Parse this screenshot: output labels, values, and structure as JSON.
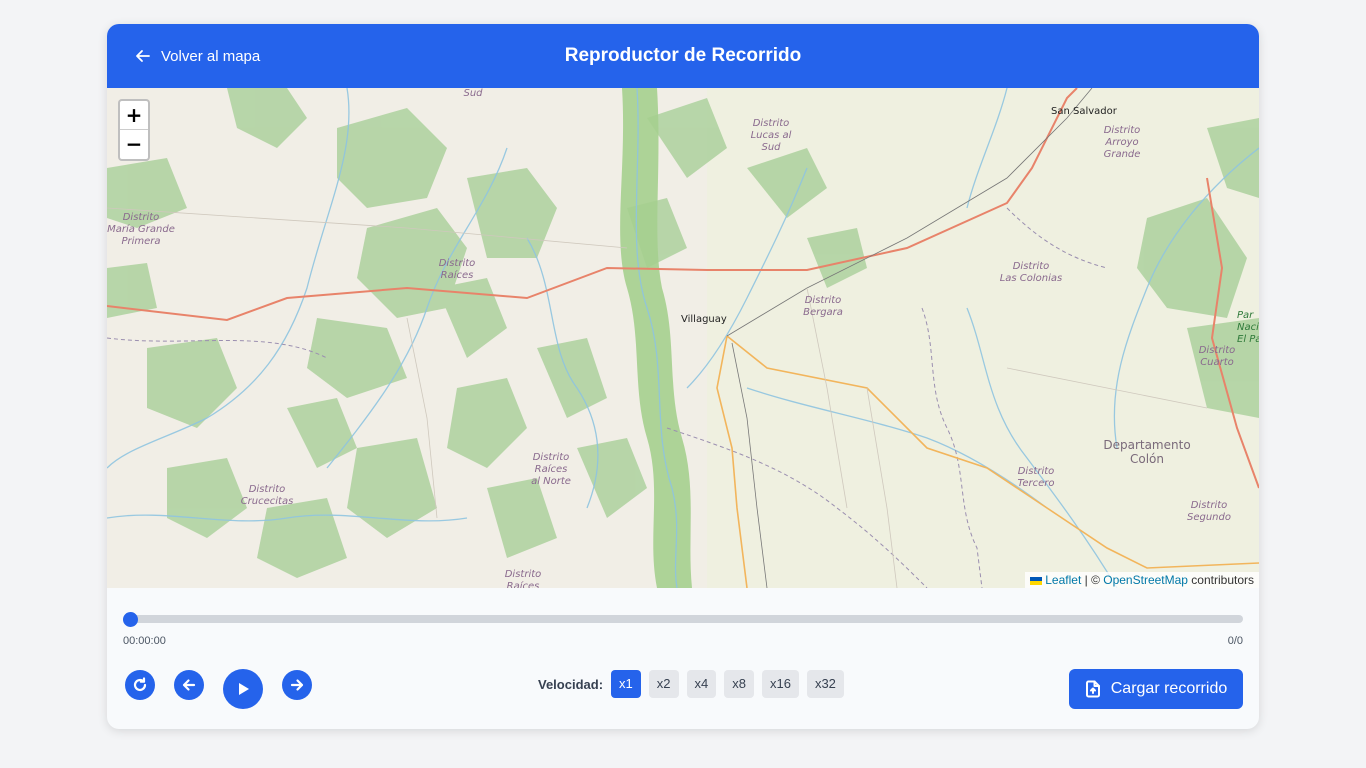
{
  "header": {
    "back_label": "Volver al mapa",
    "title": "Reproductor de Recorrido"
  },
  "map": {
    "zoom_in": "+",
    "zoom_out": "−",
    "attribution": {
      "leaflet": "Leaflet",
      "separator": " | © ",
      "osm": "OpenStreetMap",
      "suffix": " contributors"
    },
    "labels": {
      "sud_top": "Sud",
      "san_salvador": "San Salvador",
      "lucas_al_sud": "Distrito\nLucas al\nSud",
      "arroyo_grande": "Distrito\nArroyo\nGrande",
      "maria_grande": "Distrito\nMaría Grande\nPrimera",
      "raices": "Distrito\nRaíces",
      "las_colonias": "Distrito\nLas Colonias",
      "bergara": "Distrito\nBergara",
      "villaguay": "Villaguay",
      "parque": "Par\nNaci\nEl Pa",
      "cuarto": "Distrito\nCuarto",
      "departamento_colon": "Departamento\nColón",
      "raices_al_norte": "Distrito\nRaíces\nal Norte",
      "crucecitas": "Distrito\nCrucecitas",
      "tercero": "Distrito\nTercero",
      "segundo": "Distrito\nSegundo",
      "raices_bottom": "Distrito\nRaíces"
    }
  },
  "player": {
    "progress": 0,
    "time_current": "00:00:00",
    "counter": "0/0",
    "speed_label": "Velocidad:",
    "speeds": [
      "x1",
      "x2",
      "x4",
      "x8",
      "x16",
      "x32"
    ],
    "active_speed": "x1",
    "load_label": "Cargar recorrido"
  },
  "colors": {
    "primary": "#2563eb",
    "map_bg": "#f2efe6",
    "forest": "#add19e",
    "river": "#8fc4e0",
    "highway": "#e8836a",
    "road": "#f2b55c"
  }
}
